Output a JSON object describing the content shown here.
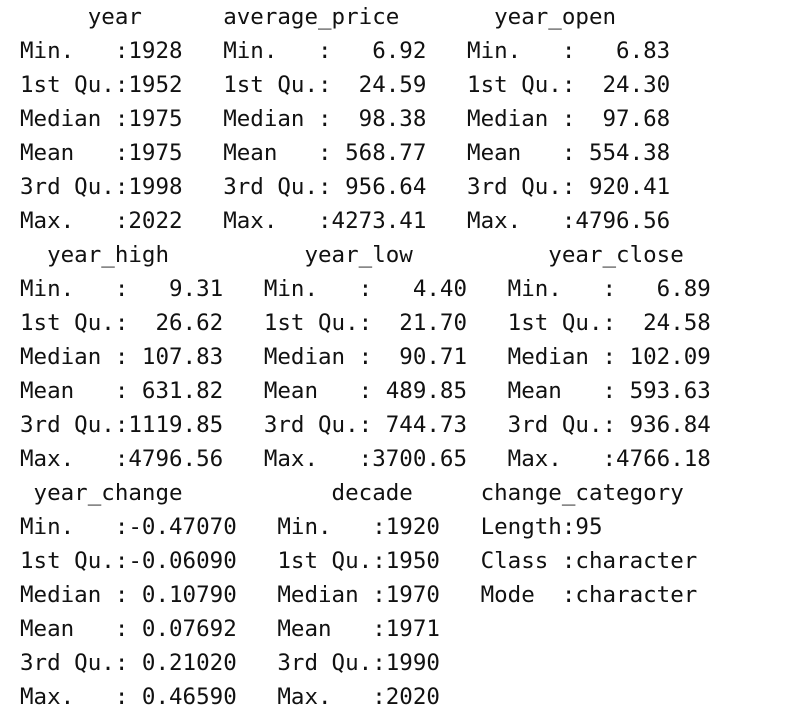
{
  "summary_output": {
    "blocks": [
      {
        "header": "     year      average_price       year_open     ",
        "rows": [
          "Min.   :1928   Min.   :   6.92   Min.   :   6.83  ",
          "1st Qu.:1952   1st Qu.:  24.59   1st Qu.:  24.30  ",
          "Median :1975   Median :  98.38   Median :  97.68  ",
          "Mean   :1975   Mean   : 568.77   Mean   : 554.38  ",
          "3rd Qu.:1998   3rd Qu.: 956.64   3rd Qu.: 920.41  ",
          "Max.   :2022   Max.   :4273.41   Max.   :4796.56  "
        ]
      },
      {
        "header": "  year_high          year_low          year_close     ",
        "rows": [
          "Min.   :   9.31   Min.   :   4.40   Min.   :   6.89  ",
          "1st Qu.:  26.62   1st Qu.:  21.70   1st Qu.:  24.58  ",
          "Median : 107.83   Median :  90.71   Median : 102.09  ",
          "Mean   : 631.82   Mean   : 489.85   Mean   : 593.63  ",
          "3rd Qu.:1119.85   3rd Qu.: 744.73   3rd Qu.: 936.84  ",
          "Max.   :4796.56   Max.   :3700.65   Max.   :4766.18  "
        ]
      },
      {
        "header": " year_change           decade     change_category   ",
        "rows": [
          "Min.   :-0.47070   Min.   :1920   Length:95         ",
          "1st Qu.:-0.06090   1st Qu.:1950   Class :character  ",
          "Median : 0.10790   Median :1970   Mode  :character  ",
          "Mean   : 0.07692   Mean   :1971                     ",
          "3rd Qu.: 0.21020   3rd Qu.:1990                     ",
          "Max.   : 0.46590   Max.   :2020                     "
        ]
      }
    ]
  }
}
